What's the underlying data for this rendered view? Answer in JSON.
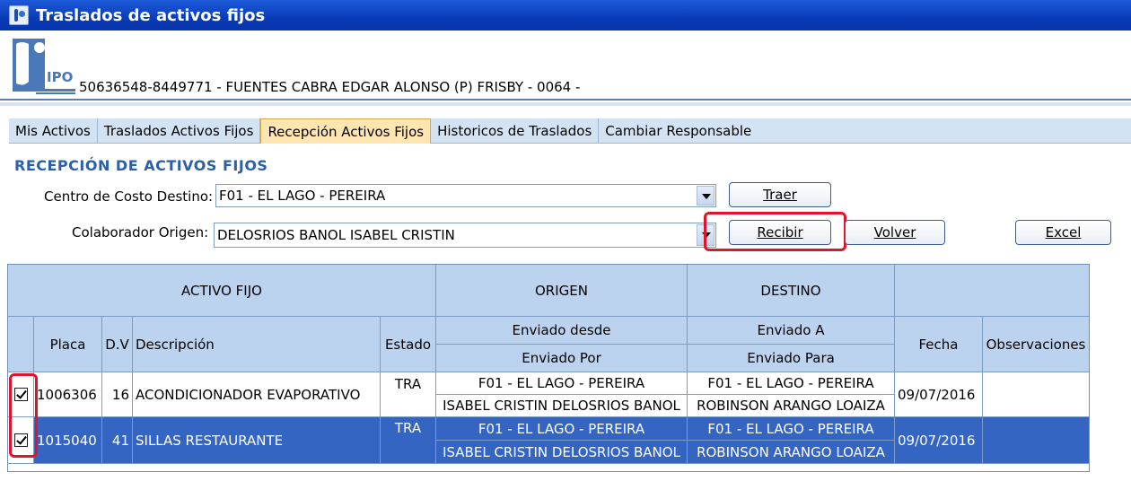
{
  "window": {
    "title": "Traslados de activos fijos"
  },
  "header": {
    "logo_text": "IPO",
    "user_line": "50636548-8449771 - FUENTES CABRA EDGAR ALONSO (P)  FRISBY - 0064 -"
  },
  "tabs": [
    {
      "label": "Mis Activos",
      "active": false
    },
    {
      "label": "Traslados Activos Fijos",
      "active": false
    },
    {
      "label": "Recepción Activos Fijos",
      "active": true
    },
    {
      "label": "Historicos de Traslados",
      "active": false
    },
    {
      "label": "Cambiar Responsable",
      "active": false
    }
  ],
  "section_title": "RECEPCIÓN DE ACTIVOS FIJOS",
  "form": {
    "centro_label": "Centro de Costo Destino:",
    "centro_value": "F01 - EL LAGO - PEREIRA",
    "colaborador_label": "Colaborador Origen:",
    "colaborador_value": "DELOSRIOS BANOL ISABEL CRISTIN"
  },
  "buttons": {
    "traer": "Traer",
    "recibir": "Recibir",
    "volver": "Volver",
    "excel": "Excel"
  },
  "table": {
    "group_headers": {
      "activo": "ACTIVO FIJO",
      "origen": "ORIGEN",
      "destino": "DESTINO"
    },
    "headers": {
      "placa": "Placa",
      "dv": "D.V",
      "descripcion": "Descripción",
      "estado": "Estado",
      "enviado_desde": "Enviado desde",
      "enviado_por": "Enviado Por",
      "enviado_a": "Enviado A",
      "enviado_para": "Enviado Para",
      "fecha": "Fecha",
      "observaciones": "Observaciones"
    },
    "rows": [
      {
        "checked": true,
        "placa": "1006306",
        "dv": "16",
        "descripcion": "ACONDICIONADOR EVAPORATIVO",
        "estado": "TRA",
        "enviado_desde": "F01 - EL LAGO - PEREIRA",
        "enviado_por": "ISABEL CRISTIN DELOSRIOS BANOL",
        "enviado_a": "F01 - EL LAGO - PEREIRA",
        "enviado_para": "ROBINSON  ARANGO LOAIZA",
        "fecha": "09/07/2016",
        "observaciones": ""
      },
      {
        "checked": true,
        "placa": "1015040",
        "dv": "41",
        "descripcion": "SILLAS RESTAURANTE",
        "estado": "TRA",
        "enviado_desde": "F01 - EL LAGO - PEREIRA",
        "enviado_por": "ISABEL CRISTIN DELOSRIOS BANOL",
        "enviado_a": "F01 - EL LAGO - PEREIRA",
        "enviado_para": "ROBINSON  ARANGO LOAIZA",
        "fecha": "09/07/2016",
        "observaciones": ""
      }
    ]
  }
}
